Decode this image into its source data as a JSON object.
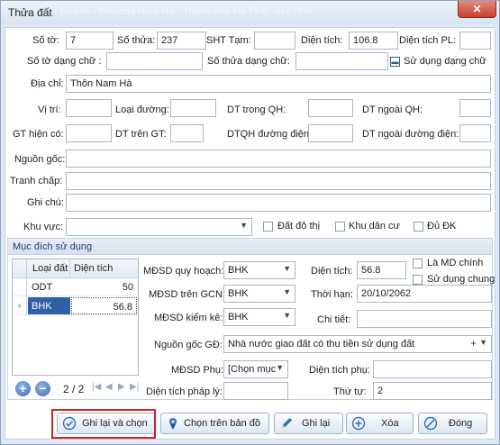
{
  "window": {
    "title": "Thửa đất",
    "subtitle_blurred": "Lưu tờ - Phường Nam Hà - Thành phố Hà Tĩnh - Hà Tĩnh",
    "close_glyph": "✕"
  },
  "form": {
    "so_to": {
      "label": "Số tờ:",
      "value": "7"
    },
    "so_thua": {
      "label": "Số thửa:",
      "value": "237"
    },
    "sht_tam": {
      "label": "SHT Tạm:",
      "value": ""
    },
    "dien_tich": {
      "label": "Diện tích:",
      "value": "106.8"
    },
    "dien_tich_pl": {
      "label": "Diện tích PL:",
      "value": ""
    },
    "so_to_chu": {
      "label": "Số tờ dạng chữ :",
      "value": ""
    },
    "so_thua_chu": {
      "label": "Số thửa dạng chữ:",
      "value": ""
    },
    "su_dung_dang_chu": {
      "label": "Sử dụng dạng chữ",
      "checked": true
    },
    "dia_chi": {
      "label": "Địa chỉ:",
      "value": "Thôn Nam Hà"
    },
    "vi_tri": {
      "label": "Vị trí:",
      "value": ""
    },
    "loai_duong": {
      "label": "Loại đường:",
      "value": ""
    },
    "dt_trong_qh": {
      "label": "DT trong QH:",
      "value": ""
    },
    "dt_ngoai_qh": {
      "label": "DT ngoài QH:",
      "value": ""
    },
    "gt_hien_co": {
      "label": "GT hiện có:",
      "value": ""
    },
    "dt_tren_gt": {
      "label": "DT trên GT:",
      "value": ""
    },
    "dtqh_duong_dien": {
      "label": "DTQH đường điện:",
      "value": ""
    },
    "dt_ngoai_duong_dien": {
      "label": "DT ngoài đường điện:",
      "value": ""
    },
    "nguon_goc": {
      "label": "Nguồn gốc:",
      "value": ""
    },
    "tranh_chap": {
      "label": "Tranh chấp:",
      "value": ""
    },
    "ghi_chu": {
      "label": "Ghi chú:",
      "value": ""
    },
    "khu_vuc": {
      "label": "Khu vực:",
      "value": ""
    },
    "dat_do_thi": {
      "label": "Đất đô thị",
      "checked": false
    },
    "khu_dan_cu": {
      "label": "Khu dân cư",
      "checked": false
    },
    "du_dk": {
      "label": "Đủ ĐK",
      "checked": false
    }
  },
  "muc_dich": {
    "title": "Mục đích sử dụng",
    "columns": [
      "Loại đất",
      "Diện tích"
    ],
    "rows": [
      {
        "loai": "ODT",
        "dien_tich": "50"
      },
      {
        "loai": "BHK",
        "dien_tich": "56.8"
      }
    ],
    "nav": {
      "text": "2 / 2",
      "add": "+",
      "remove": "−",
      "first": "|◀",
      "prev": "◀",
      "next": "▶",
      "last": "▶|"
    },
    "mdsd_quy_hoach": {
      "label": "MĐSD quy hoạch:",
      "value": "BHK"
    },
    "mdsd_tren_gcn": {
      "label": "MĐSD trên GCN:",
      "value": "BHK"
    },
    "mdsd_kiem_ke": {
      "label": "MĐSD kiểm kê:",
      "value": "BHK"
    },
    "dien_tich": {
      "label": "Diện tích:",
      "value": "56.8"
    },
    "thoi_han": {
      "label": "Thời hạn:",
      "value": "20/10/2062"
    },
    "chi_tiet": {
      "label": "Chi tiết:",
      "value": ""
    },
    "la_md_chinh": {
      "label": "Là MD chính",
      "checked": false
    },
    "su_dung_chung": {
      "label": "Sử dụng chung",
      "checked": false
    },
    "nguon_goc_gd": {
      "label": "Nguồn gốc GĐ:",
      "value": "Nhà nước giao đất có thu tiền sử dụng đất"
    },
    "mdsd_phu": {
      "label": "MĐSD Phụ:",
      "value": "[Chọn mục"
    },
    "dien_tich_phu": {
      "label": "Diện tích phụ:",
      "value": ""
    },
    "dien_tich_phap_ly": {
      "label": "Diện tích pháp lý:",
      "value": ""
    },
    "thu_tu": {
      "label": "Thứ tự:",
      "value": "2"
    }
  },
  "buttons": {
    "ghi_lai_va_chon": "Ghi lại và chọn",
    "chon_tren_ban_do": "Chọn trên bản đồ",
    "ghi_lai": "Ghi lại",
    "xoa": "Xóa",
    "dong": "Đóng"
  },
  "colors": {
    "accent": "#2f5fa5",
    "highlight": "#d62020"
  }
}
